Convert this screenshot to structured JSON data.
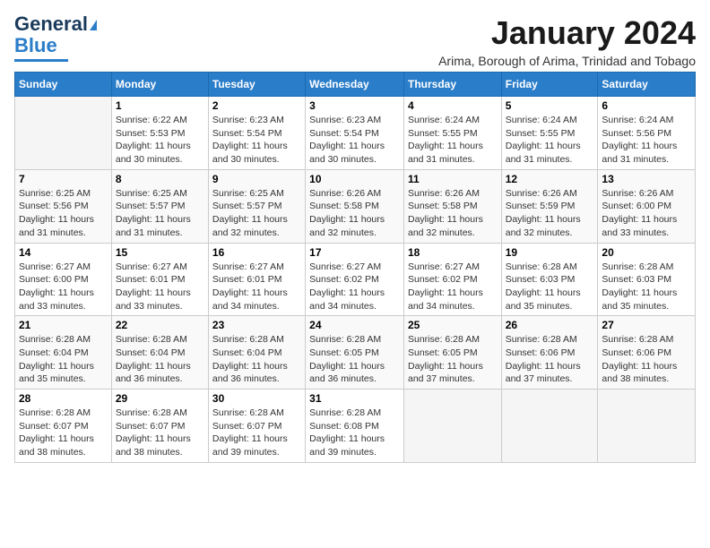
{
  "header": {
    "logo": {
      "line1": "General",
      "line2": "Blue"
    },
    "title": "January 2024",
    "subtitle": "Arima, Borough of Arima, Trinidad and Tobago"
  },
  "columns": [
    "Sunday",
    "Monday",
    "Tuesday",
    "Wednesday",
    "Thursday",
    "Friday",
    "Saturday"
  ],
  "weeks": [
    [
      {
        "day": "",
        "sunrise": "",
        "sunset": "",
        "daylight": ""
      },
      {
        "day": "1",
        "sunrise": "Sunrise: 6:22 AM",
        "sunset": "Sunset: 5:53 PM",
        "daylight": "Daylight: 11 hours and 30 minutes."
      },
      {
        "day": "2",
        "sunrise": "Sunrise: 6:23 AM",
        "sunset": "Sunset: 5:54 PM",
        "daylight": "Daylight: 11 hours and 30 minutes."
      },
      {
        "day": "3",
        "sunrise": "Sunrise: 6:23 AM",
        "sunset": "Sunset: 5:54 PM",
        "daylight": "Daylight: 11 hours and 30 minutes."
      },
      {
        "day": "4",
        "sunrise": "Sunrise: 6:24 AM",
        "sunset": "Sunset: 5:55 PM",
        "daylight": "Daylight: 11 hours and 31 minutes."
      },
      {
        "day": "5",
        "sunrise": "Sunrise: 6:24 AM",
        "sunset": "Sunset: 5:55 PM",
        "daylight": "Daylight: 11 hours and 31 minutes."
      },
      {
        "day": "6",
        "sunrise": "Sunrise: 6:24 AM",
        "sunset": "Sunset: 5:56 PM",
        "daylight": "Daylight: 11 hours and 31 minutes."
      }
    ],
    [
      {
        "day": "7",
        "sunrise": "Sunrise: 6:25 AM",
        "sunset": "Sunset: 5:56 PM",
        "daylight": "Daylight: 11 hours and 31 minutes."
      },
      {
        "day": "8",
        "sunrise": "Sunrise: 6:25 AM",
        "sunset": "Sunset: 5:57 PM",
        "daylight": "Daylight: 11 hours and 31 minutes."
      },
      {
        "day": "9",
        "sunrise": "Sunrise: 6:25 AM",
        "sunset": "Sunset: 5:57 PM",
        "daylight": "Daylight: 11 hours and 32 minutes."
      },
      {
        "day": "10",
        "sunrise": "Sunrise: 6:26 AM",
        "sunset": "Sunset: 5:58 PM",
        "daylight": "Daylight: 11 hours and 32 minutes."
      },
      {
        "day": "11",
        "sunrise": "Sunrise: 6:26 AM",
        "sunset": "Sunset: 5:58 PM",
        "daylight": "Daylight: 11 hours and 32 minutes."
      },
      {
        "day": "12",
        "sunrise": "Sunrise: 6:26 AM",
        "sunset": "Sunset: 5:59 PM",
        "daylight": "Daylight: 11 hours and 32 minutes."
      },
      {
        "day": "13",
        "sunrise": "Sunrise: 6:26 AM",
        "sunset": "Sunset: 6:00 PM",
        "daylight": "Daylight: 11 hours and 33 minutes."
      }
    ],
    [
      {
        "day": "14",
        "sunrise": "Sunrise: 6:27 AM",
        "sunset": "Sunset: 6:00 PM",
        "daylight": "Daylight: 11 hours and 33 minutes."
      },
      {
        "day": "15",
        "sunrise": "Sunrise: 6:27 AM",
        "sunset": "Sunset: 6:01 PM",
        "daylight": "Daylight: 11 hours and 33 minutes."
      },
      {
        "day": "16",
        "sunrise": "Sunrise: 6:27 AM",
        "sunset": "Sunset: 6:01 PM",
        "daylight": "Daylight: 11 hours and 34 minutes."
      },
      {
        "day": "17",
        "sunrise": "Sunrise: 6:27 AM",
        "sunset": "Sunset: 6:02 PM",
        "daylight": "Daylight: 11 hours and 34 minutes."
      },
      {
        "day": "18",
        "sunrise": "Sunrise: 6:27 AM",
        "sunset": "Sunset: 6:02 PM",
        "daylight": "Daylight: 11 hours and 34 minutes."
      },
      {
        "day": "19",
        "sunrise": "Sunrise: 6:28 AM",
        "sunset": "Sunset: 6:03 PM",
        "daylight": "Daylight: 11 hours and 35 minutes."
      },
      {
        "day": "20",
        "sunrise": "Sunrise: 6:28 AM",
        "sunset": "Sunset: 6:03 PM",
        "daylight": "Daylight: 11 hours and 35 minutes."
      }
    ],
    [
      {
        "day": "21",
        "sunrise": "Sunrise: 6:28 AM",
        "sunset": "Sunset: 6:04 PM",
        "daylight": "Daylight: 11 hours and 35 minutes."
      },
      {
        "day": "22",
        "sunrise": "Sunrise: 6:28 AM",
        "sunset": "Sunset: 6:04 PM",
        "daylight": "Daylight: 11 hours and 36 minutes."
      },
      {
        "day": "23",
        "sunrise": "Sunrise: 6:28 AM",
        "sunset": "Sunset: 6:04 PM",
        "daylight": "Daylight: 11 hours and 36 minutes."
      },
      {
        "day": "24",
        "sunrise": "Sunrise: 6:28 AM",
        "sunset": "Sunset: 6:05 PM",
        "daylight": "Daylight: 11 hours and 36 minutes."
      },
      {
        "day": "25",
        "sunrise": "Sunrise: 6:28 AM",
        "sunset": "Sunset: 6:05 PM",
        "daylight": "Daylight: 11 hours and 37 minutes."
      },
      {
        "day": "26",
        "sunrise": "Sunrise: 6:28 AM",
        "sunset": "Sunset: 6:06 PM",
        "daylight": "Daylight: 11 hours and 37 minutes."
      },
      {
        "day": "27",
        "sunrise": "Sunrise: 6:28 AM",
        "sunset": "Sunset: 6:06 PM",
        "daylight": "Daylight: 11 hours and 38 minutes."
      }
    ],
    [
      {
        "day": "28",
        "sunrise": "Sunrise: 6:28 AM",
        "sunset": "Sunset: 6:07 PM",
        "daylight": "Daylight: 11 hours and 38 minutes."
      },
      {
        "day": "29",
        "sunrise": "Sunrise: 6:28 AM",
        "sunset": "Sunset: 6:07 PM",
        "daylight": "Daylight: 11 hours and 38 minutes."
      },
      {
        "day": "30",
        "sunrise": "Sunrise: 6:28 AM",
        "sunset": "Sunset: 6:07 PM",
        "daylight": "Daylight: 11 hours and 39 minutes."
      },
      {
        "day": "31",
        "sunrise": "Sunrise: 6:28 AM",
        "sunset": "Sunset: 6:08 PM",
        "daylight": "Daylight: 11 hours and 39 minutes."
      },
      {
        "day": "",
        "sunrise": "",
        "sunset": "",
        "daylight": ""
      },
      {
        "day": "",
        "sunrise": "",
        "sunset": "",
        "daylight": ""
      },
      {
        "day": "",
        "sunrise": "",
        "sunset": "",
        "daylight": ""
      }
    ]
  ]
}
